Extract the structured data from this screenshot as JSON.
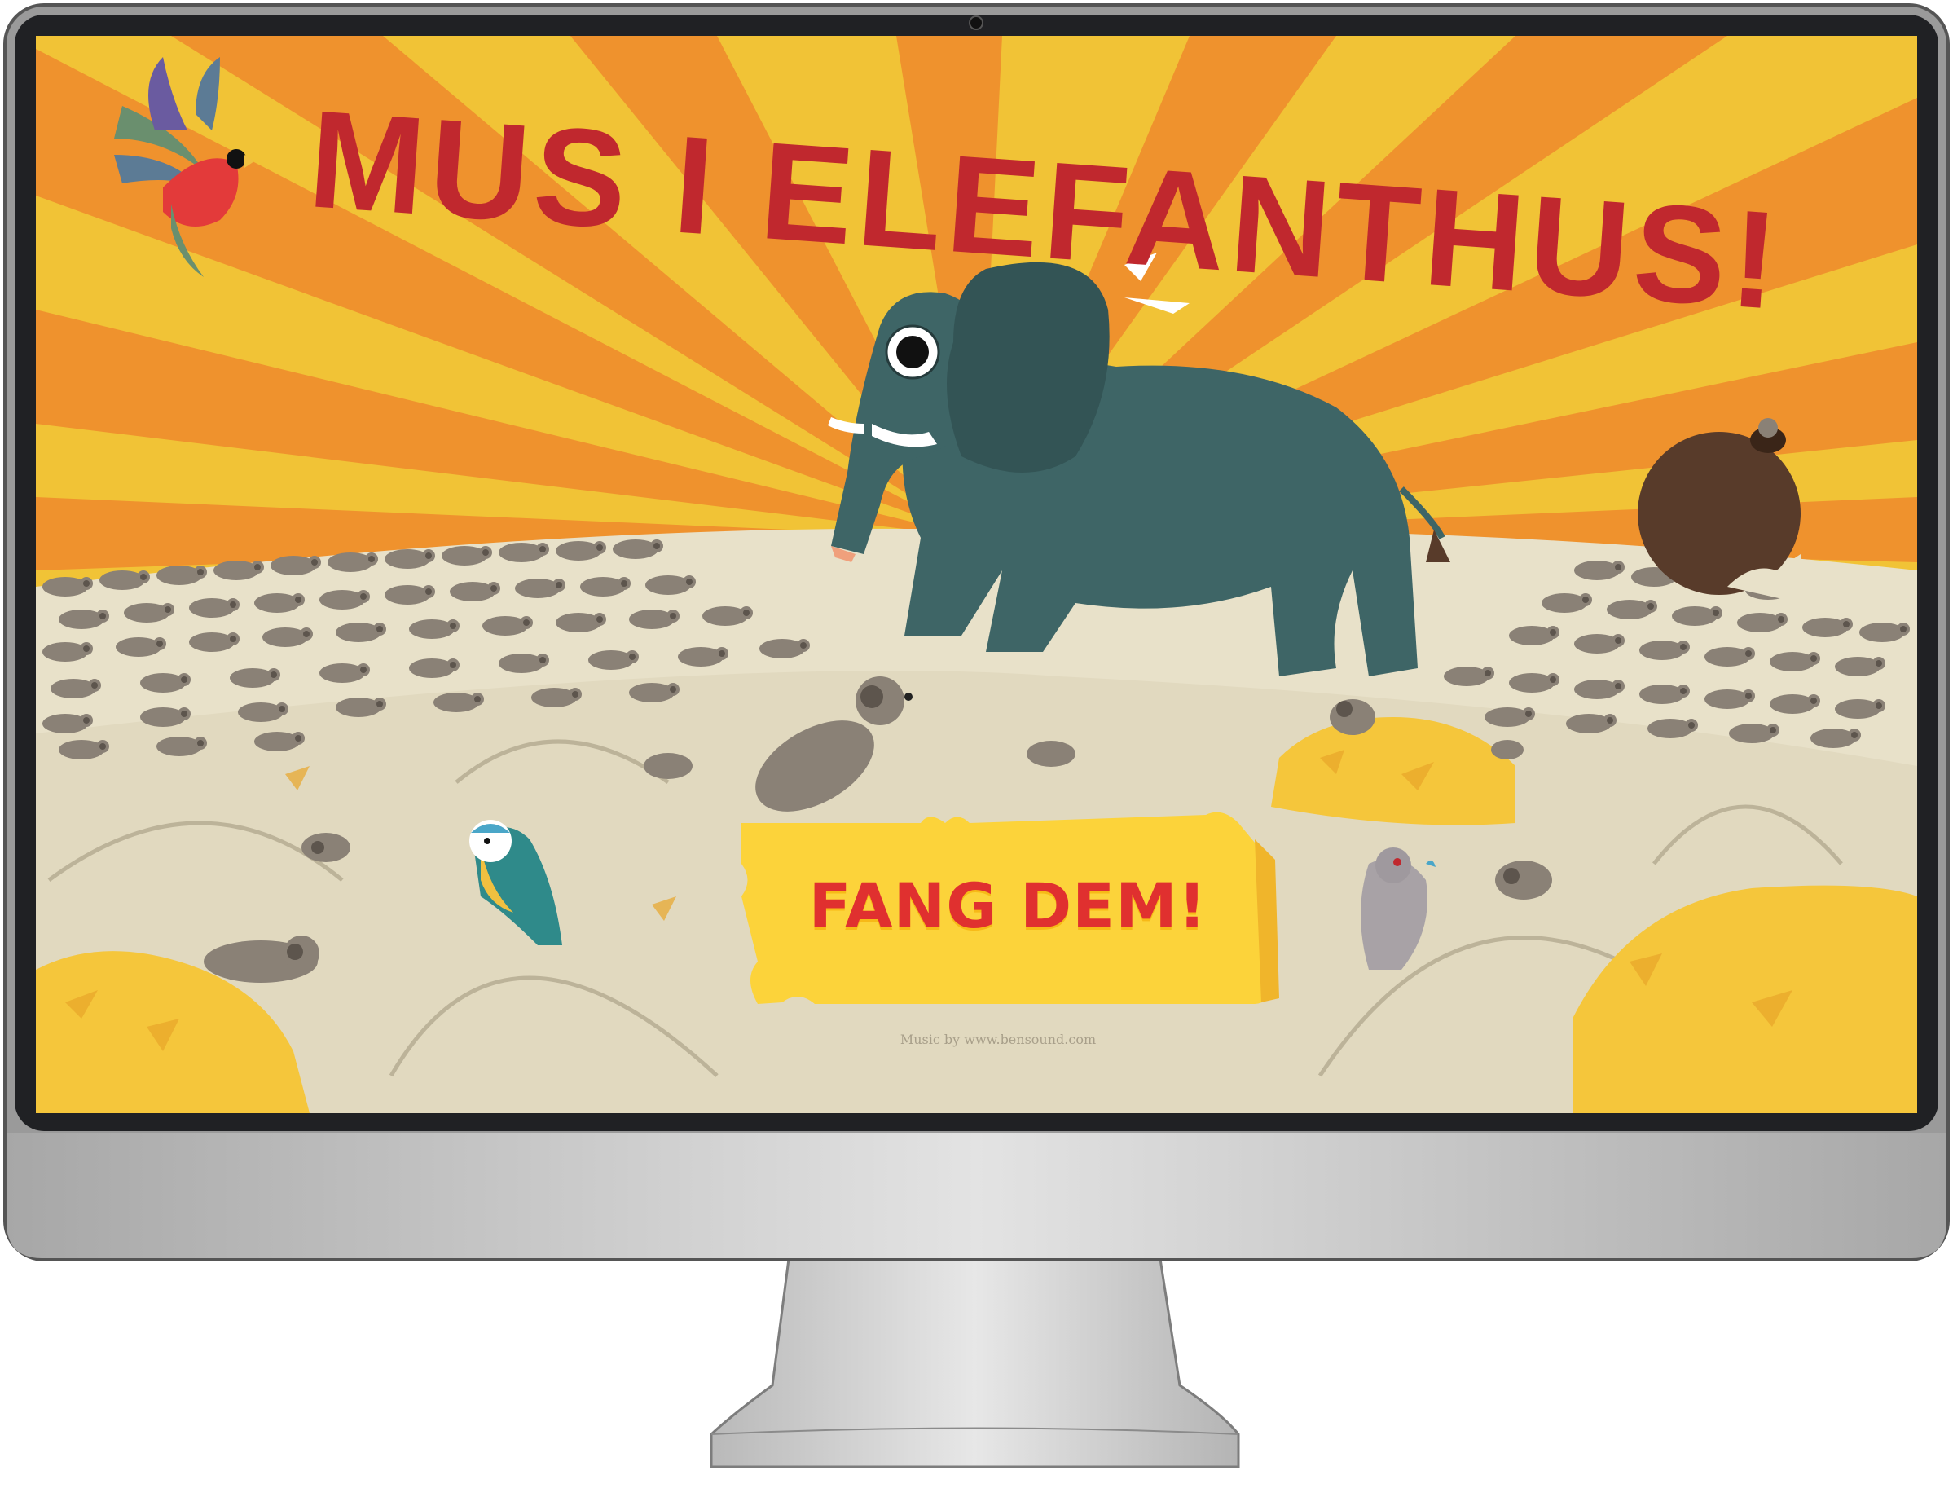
{
  "game": {
    "title": "MUS I ELEFANTHUS!",
    "play_button_label": "FANG DEM!",
    "credit": "Music by www.bensound.com"
  },
  "colors": {
    "title_red": "#c0282e",
    "button_yellow": "#fcd33a",
    "button_text_red": "#e0302f",
    "sky_orange": "#ef922d",
    "sky_yellow": "#f1c336",
    "ground_sand": "#e1dac2",
    "elephant_teal": "#3e6566",
    "hay_yellow": "#f5c63b",
    "mouse_grey": "#8a8176"
  },
  "icons": [
    "parrot-icon",
    "elephant-icon",
    "mouse-icon",
    "blue-tit-icon",
    "pigeon-icon",
    "coconut-icon",
    "hay-icon",
    "webcam-icon"
  ]
}
